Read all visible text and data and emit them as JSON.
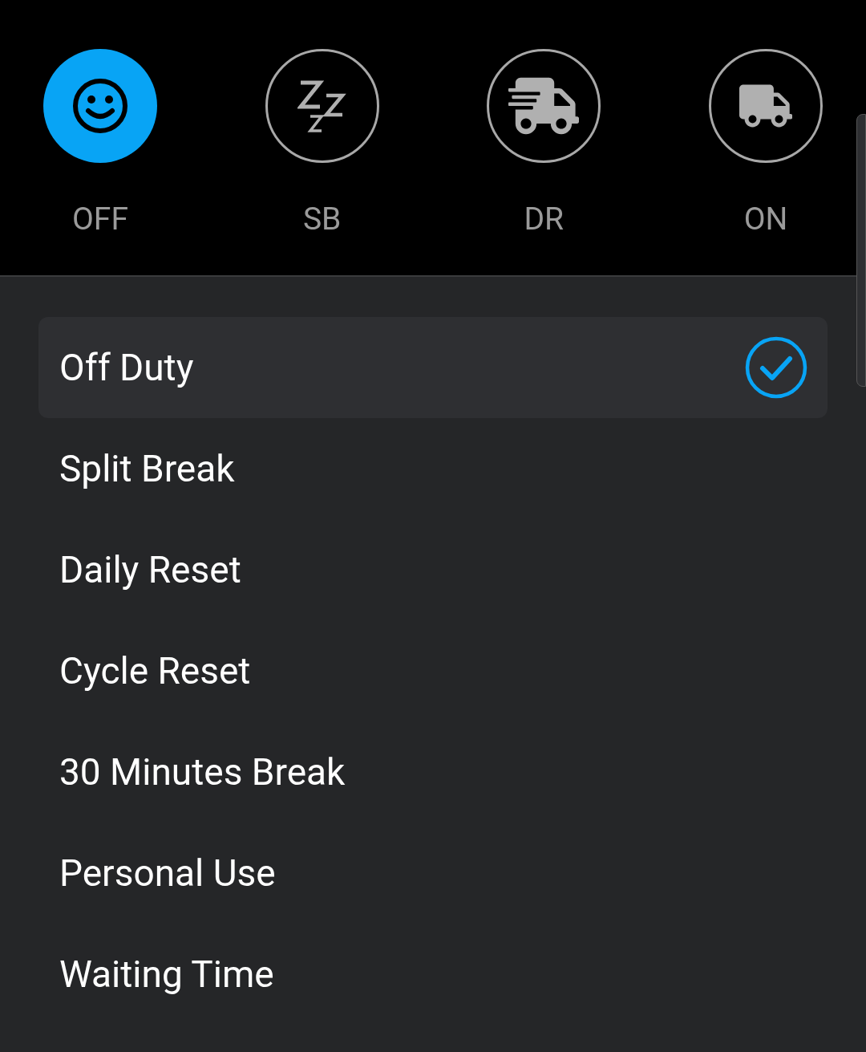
{
  "statuses": [
    {
      "label": "OFF",
      "kind": "smile",
      "selected": true
    },
    {
      "label": "SB",
      "kind": "sleep",
      "selected": false
    },
    {
      "label": "DR",
      "kind": "fast-truck",
      "selected": false
    },
    {
      "label": "ON",
      "kind": "truck",
      "selected": false
    }
  ],
  "options": [
    {
      "label": "Off Duty",
      "selected": true
    },
    {
      "label": "Split Break",
      "selected": false
    },
    {
      "label": "Daily Reset",
      "selected": false
    },
    {
      "label": "Cycle Reset",
      "selected": false
    },
    {
      "label": "30 Minutes Break",
      "selected": false
    },
    {
      "label": "Personal Use",
      "selected": false
    },
    {
      "label": "Waiting Time",
      "selected": false
    }
  ]
}
